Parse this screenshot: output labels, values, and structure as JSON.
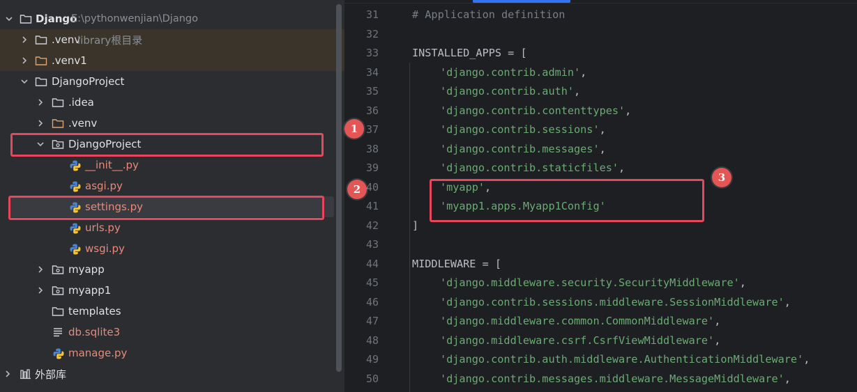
{
  "tree": {
    "root": {
      "label": "Django",
      "path": "E:\\pythonwenjian\\Django"
    },
    "items": [
      {
        "label": ".venv",
        "suffix": "library根目录"
      },
      {
        "label": ".venv1"
      },
      {
        "label": "DjangoProject"
      },
      {
        "label": ".idea"
      },
      {
        "label": ".venv"
      },
      {
        "label": "DjangoProject"
      },
      {
        "label": "__init__.py"
      },
      {
        "label": "asgi.py"
      },
      {
        "label": "settings.py"
      },
      {
        "label": "urls.py"
      },
      {
        "label": "wsgi.py"
      },
      {
        "label": "myapp"
      },
      {
        "label": "myapp1"
      },
      {
        "label": "templates"
      },
      {
        "label": "db.sqlite3"
      },
      {
        "label": "manage.py"
      },
      {
        "label": "外部库"
      }
    ]
  },
  "editor": {
    "lines": [
      {
        "num": "31",
        "text": "# Application definition"
      },
      {
        "num": "32",
        "text": ""
      },
      {
        "num": "33",
        "text": "INSTALLED_APPS = ["
      },
      {
        "num": "34",
        "text": "'django.contrib.admin'",
        "tail": ","
      },
      {
        "num": "35",
        "text": "'django.contrib.auth'",
        "tail": ","
      },
      {
        "num": "36",
        "text": "'django.contrib.contenttypes'",
        "tail": ","
      },
      {
        "num": "37",
        "text": "'django.contrib.sessions'",
        "tail": ","
      },
      {
        "num": "38",
        "text": "'django.contrib.messages'",
        "tail": ","
      },
      {
        "num": "39",
        "text": "'django.contrib.staticfiles'",
        "tail": ","
      },
      {
        "num": "40",
        "text": "'myapp'",
        "tail": ","
      },
      {
        "num": "41",
        "text": "'myapp1.apps.Myapp1Config'",
        "tail": ""
      },
      {
        "num": "42",
        "text": "]"
      },
      {
        "num": "43",
        "text": ""
      },
      {
        "num": "44",
        "text": "MIDDLEWARE = ["
      },
      {
        "num": "45",
        "text": "'django.middleware.security.SecurityMiddleware'",
        "tail": ","
      },
      {
        "num": "46",
        "text": "'django.contrib.sessions.middleware.SessionMiddleware'",
        "tail": ","
      },
      {
        "num": "47",
        "text": "'django.middleware.common.CommonMiddleware'",
        "tail": ","
      },
      {
        "num": "48",
        "text": "'django.middleware.csrf.CsrfViewMiddleware'",
        "tail": ","
      },
      {
        "num": "49",
        "text": "'django.contrib.auth.middleware.AuthenticationMiddleware'",
        "tail": ","
      },
      {
        "num": "50",
        "text": "'django.contrib.messages.middleware.MessageMiddleware'",
        "tail": ","
      }
    ]
  },
  "annotations": {
    "badge1": "1",
    "badge2": "2",
    "badge3": "3"
  },
  "colors": {
    "highlight": "#e8465a",
    "badge": "#e45555",
    "string": "#6aab73",
    "accent": "#3574f0"
  }
}
